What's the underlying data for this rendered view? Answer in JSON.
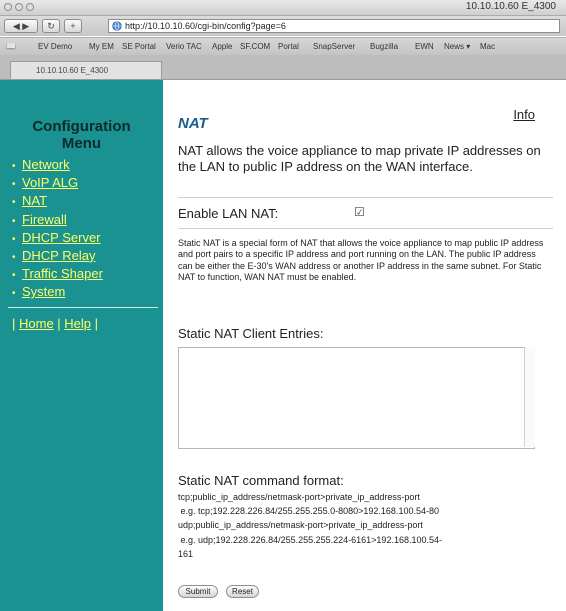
{
  "window": {
    "title": "10.10.10.60 E_4300"
  },
  "toolbar": {
    "back_icon": "back-forward-icon",
    "reload_icon": "reload-icon",
    "add_icon": "plus-icon",
    "url": "http://10.10.10.60/cgi-bin/config?page=6"
  },
  "bookmarks": [
    "EV Demo",
    "My EM",
    "SE Portal",
    "Verio TAC",
    "Apple",
    "SF.COM",
    "Portal",
    "SnapServer",
    "Bugzilla",
    "EWN",
    "News ▾",
    "Mac"
  ],
  "tab": {
    "label": "10.10.10.60 E_4300"
  },
  "sidebar": {
    "title_line1": "Configuration",
    "title_line2": "Menu",
    "items": [
      "Network",
      "VoIP ALG",
      "NAT",
      "Firewall",
      "DHCP Server",
      "DHCP Relay",
      "Traffic Shaper",
      "System"
    ],
    "home": "Home",
    "help": "Help"
  },
  "main": {
    "info": "Info",
    "title": "NAT",
    "intro": "NAT allows the voice appliance to map private IP addresses on the LAN to public IP address on the WAN interface.",
    "enable_label": "Enable LAN NAT:",
    "enable_checked": true,
    "static_desc": "Static NAT is a special form of NAT that allows the voice appliance to map public IP address and port pairs to a specific IP address and port running on the LAN. The public IP address can be either the E-30's WAN address or another IP address in the same subnet. For Static NAT to function, WAN NAT must be enabled.",
    "entries_label": "Static NAT Client Entries:",
    "entries_value": "",
    "format_title": "Static NAT command format:",
    "format_lines": [
      "tcp;public_ip_address/netmask-port>private_ip_address-port",
      " e.g. tcp;192.228.226.84/255.255.255.0-8080>192.168.100.54-80",
      "udp;public_ip_address/netmask-port>private_ip_address-port",
      " e.g. udp;192.228.226.84/255.255.255.224-6161>192.168.100.54-",
      "161"
    ],
    "submit": "Submit",
    "reset": "Reset"
  },
  "colors": {
    "sidebar_bg": "#199291",
    "menu_link": "#ffff66",
    "title_blue": "#1b5d8c"
  }
}
